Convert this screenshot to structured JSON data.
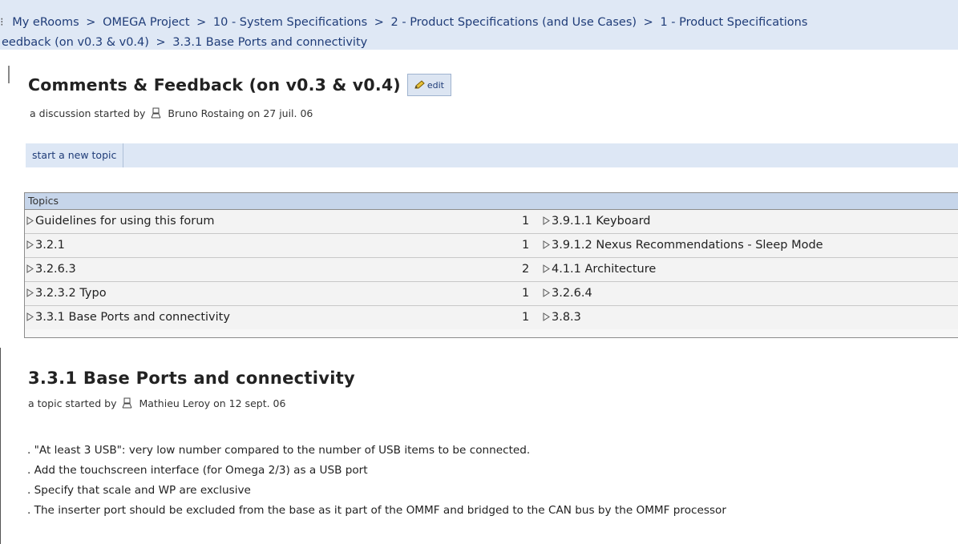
{
  "breadcrumb": {
    "prefix": "⁝",
    "items": [
      "My eRooms",
      "OMEGA Project",
      "10 - System Specifications",
      "2 - Product Specifications (and Use Cases)",
      "1 - Product Specifications"
    ],
    "line2_items": [
      "eedback (on v0.3 & v0.4)",
      "3.3.1 Base Ports and connectivity"
    ],
    "separator": ">"
  },
  "discussion": {
    "title": "Comments & Feedback (on v0.3 & v0.4)",
    "edit_label": "edit",
    "started_prefix": "a discussion started by",
    "author": "Bruno Rostaing",
    "on": "on",
    "date": "27 juil. 06"
  },
  "new_topic_label": "start a new topic",
  "topics": {
    "header": "Topics",
    "rows": [
      {
        "left": "Guidelines for using this forum",
        "count": "1",
        "right": "3.9.1.1 Keyboard"
      },
      {
        "left": "3.2.1",
        "count": "1",
        "right": "3.9.1.2 Nexus Recommendations - Sleep Mode"
      },
      {
        "left": "3.2.6.3",
        "count": "2",
        "right": "4.1.1 Architecture"
      },
      {
        "left": "3.2.3.2 Typo",
        "count": "1",
        "right": "3.2.6.4"
      },
      {
        "left": "3.3.1 Base Ports and connectivity",
        "count": "1",
        "right": "3.8.3"
      }
    ]
  },
  "topic": {
    "title": "3.3.1 Base Ports and connectivity",
    "started_prefix": "a topic started by",
    "author": "Mathieu Leroy",
    "on": "on",
    "date": "12 sept. 06"
  },
  "comments": [
    ". \"At least 3 USB\": very low number compared to the number of USB items to be connected.",
    ". Add the touchscreen interface (for Omega 2/3) as a USB port",
    ". Specify that scale and WP are exclusive",
    ". The inserter port should be excluded from the base as it part of the OMMF and bridged to the CAN bus by the OMMF processor"
  ],
  "icons": {
    "person": "person-icon",
    "pencil": "pencil-icon",
    "triangle": "triangle-right-icon"
  },
  "colors": {
    "breadcrumb_bg": "#dfe8f5",
    "link": "#1f3c78",
    "header_bg": "#c6d5ea"
  }
}
